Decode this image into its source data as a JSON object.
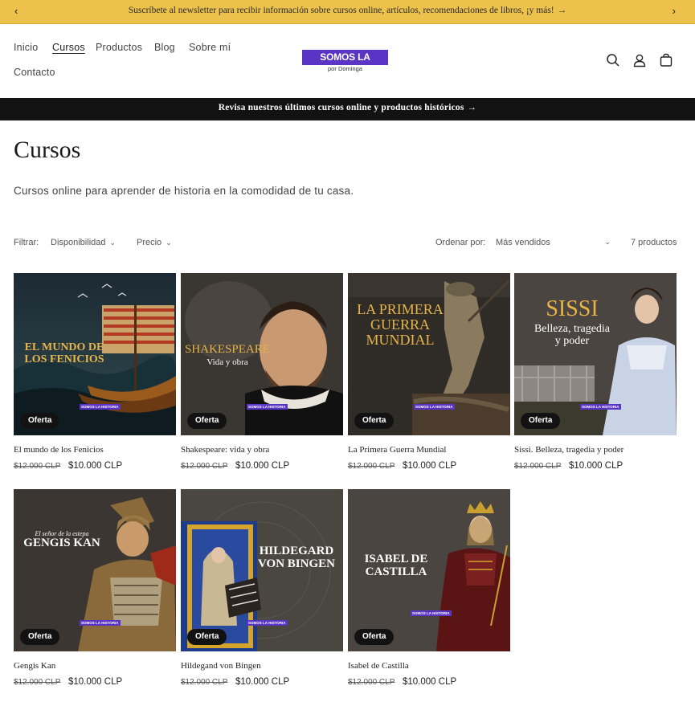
{
  "announcement": {
    "text": "Suscríbete al newsletter para recibir información sobre cursos online, artículos, recomendaciones de libros, ¡y más!",
    "arrow": "→",
    "prev": "‹",
    "next": "›"
  },
  "nav": {
    "items": [
      {
        "label": "Inicio"
      },
      {
        "label": "Cursos"
      },
      {
        "label": "Productos"
      },
      {
        "label": "Blog"
      },
      {
        "label": "Sobre mí"
      },
      {
        "label": "Contacto"
      }
    ]
  },
  "logo": {
    "title": "SOMOS LA HISTORIA",
    "subtitle": "por Dominga"
  },
  "header_icons": [
    "search-icon",
    "account-icon",
    "cart-icon"
  ],
  "promo": {
    "text": "Revisa nuestros últimos cursos online y productos históricos",
    "arrow": "→"
  },
  "page": {
    "title": "Cursos",
    "description": "Cursos online para aprender de historia en la comodidad de tu casa."
  },
  "filters": {
    "label": "Filtrar:",
    "availability": "Disponibilidad",
    "price": "Precio",
    "sort_label": "Ordenar por:",
    "sort_value": "Más vendidos",
    "count": "7 productos"
  },
  "watermark": "SOMOS LA HISTORIA",
  "products": [
    {
      "name": "El mundo de los Fenicios",
      "old_price": "$12.000 CLP",
      "price": "$10.000 CLP",
      "badge": "Oferta",
      "image_title": [
        "EL MUNDO DE",
        "LOS FENICIOS"
      ]
    },
    {
      "name": "Shakespeare: vida y obra",
      "old_price": "$12.000 CLP",
      "price": "$10.000 CLP",
      "badge": "Oferta",
      "image_title": [
        "SHAKESPEARE",
        "Vida y obra"
      ]
    },
    {
      "name": "La Primera Guerra Mundial",
      "old_price": "$12.000 CLP",
      "price": "$10.000 CLP",
      "badge": "Oferta",
      "image_title": [
        "LA PRIMERA",
        "GUERRA",
        "MUNDIAL"
      ]
    },
    {
      "name": "Sissi. Belleza, tragedia y poder",
      "old_price": "$12.000 CLP",
      "price": "$10.000 CLP",
      "badge": "Oferta",
      "image_title": [
        "SISSI",
        "Belleza, tragedia",
        "y poder"
      ]
    },
    {
      "name": "Gengis Kan",
      "old_price": "$12.000 CLP",
      "price": "$10.000 CLP",
      "badge": "Oferta",
      "image_title": [
        "El señor de la estepa",
        "GENGIS KAN"
      ]
    },
    {
      "name": "Hildegand von Bingen",
      "old_price": "$12.000 CLP",
      "price": "$10.000 CLP",
      "badge": "Oferta",
      "image_title": [
        "HILDEGARD",
        "VON BINGEN"
      ]
    },
    {
      "name": "Isabel de Castilla",
      "old_price": "$12.000 CLP",
      "price": "$10.000 CLP",
      "badge": "Oferta",
      "image_title": [
        "ISABEL DE",
        "CASTILLA"
      ]
    }
  ],
  "colors": {
    "announcement_bg": "#ecc14c",
    "promo_bg": "#121212",
    "logo_purple": "#5a34c4",
    "title_gold": "#e8b44a"
  }
}
